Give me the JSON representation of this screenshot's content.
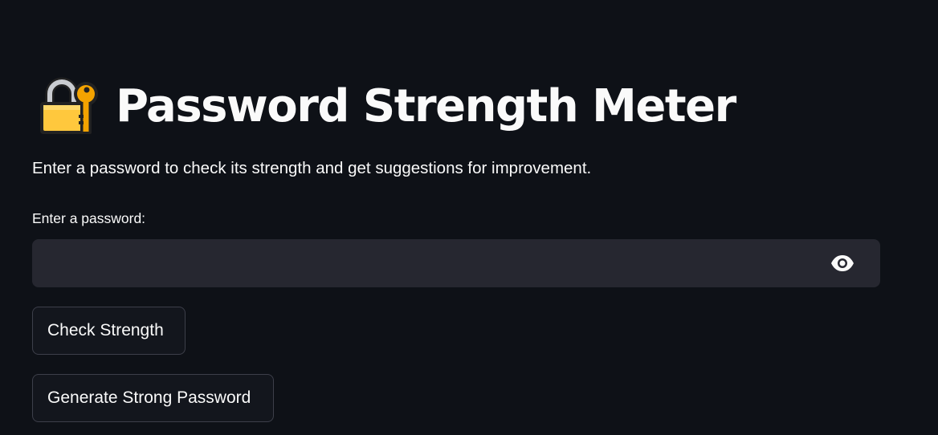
{
  "header": {
    "icon": "locked-with-key-icon",
    "title": "Password Strength Meter"
  },
  "description": "Enter a password to check its strength and get suggestions for improvement.",
  "password_field": {
    "label": "Enter a password:",
    "value": "",
    "placeholder": "",
    "toggle_icon": "eye-icon"
  },
  "buttons": {
    "check": "Check Strength",
    "generate": "Generate Strong Password"
  },
  "colors": {
    "background": "#0e1117",
    "input_background": "#262730",
    "text": "#fafafa",
    "button_border": "#3d3f4a",
    "lock_body": "#ffc83d",
    "key": "#f4a300"
  }
}
